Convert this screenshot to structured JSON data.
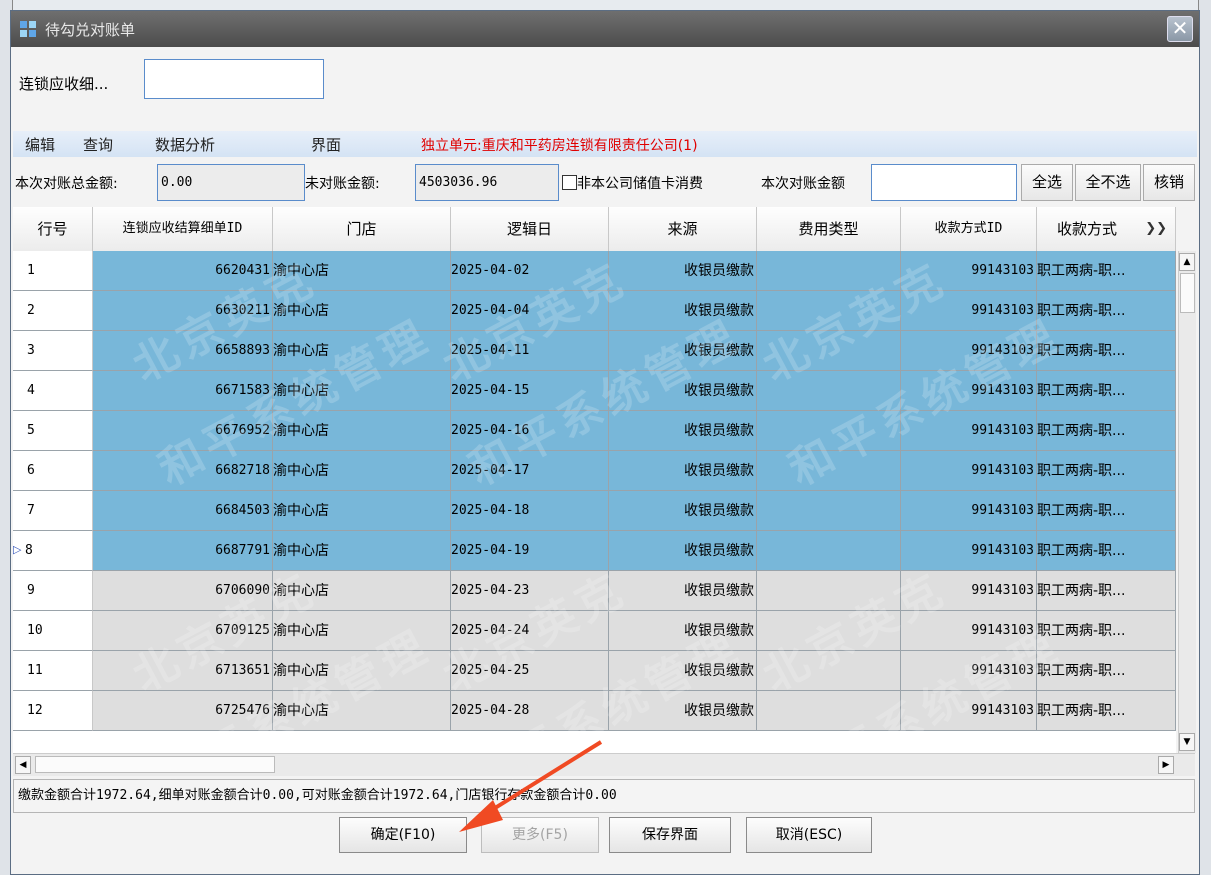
{
  "window": {
    "title": "待勾兑对账单",
    "close_symbol": "✕"
  },
  "filter": {
    "label": "连锁应收细...",
    "value": ""
  },
  "menu": {
    "items": [
      "编辑",
      "查询",
      "数据分析",
      "界面"
    ],
    "unit": "独立单元:重庆和平药房连锁有限责任公司(1)"
  },
  "toolbar": {
    "total_label": "本次对账总金额:",
    "total_value": "0.00",
    "unreconciled_label": "未对账金额:",
    "unreconciled_value": "4503036.96",
    "non_company_card_label": "非本公司储值卡消费",
    "current_amount_label": "本次对账金额",
    "current_amount_value": "",
    "select_all": "全选",
    "deselect_all": "全不选",
    "verify": "核销"
  },
  "grid": {
    "columns": [
      "行号",
      "连锁应收结算细单ID",
      "门店",
      "逻辑日",
      "来源",
      "费用类型",
      "收款方式ID",
      "收款方式"
    ],
    "rows": [
      {
        "no": "1",
        "id": "6620431",
        "store": "渝中心店",
        "date": "2025-04-02",
        "source": "收银员缴款",
        "fee": "",
        "pay_id": "99143103",
        "pay": "职工两病-职...",
        "selected": true
      },
      {
        "no": "2",
        "id": "6630211",
        "store": "渝中心店",
        "date": "2025-04-04",
        "source": "收银员缴款",
        "fee": "",
        "pay_id": "99143103",
        "pay": "职工两病-职...",
        "selected": true
      },
      {
        "no": "3",
        "id": "6658893",
        "store": "渝中心店",
        "date": "2025-04-11",
        "source": "收银员缴款",
        "fee": "",
        "pay_id": "99143103",
        "pay": "职工两病-职...",
        "selected": true
      },
      {
        "no": "4",
        "id": "6671583",
        "store": "渝中心店",
        "date": "2025-04-15",
        "source": "收银员缴款",
        "fee": "",
        "pay_id": "99143103",
        "pay": "职工两病-职...",
        "selected": true
      },
      {
        "no": "5",
        "id": "6676952",
        "store": "渝中心店",
        "date": "2025-04-16",
        "source": "收银员缴款",
        "fee": "",
        "pay_id": "99143103",
        "pay": "职工两病-职...",
        "selected": true
      },
      {
        "no": "6",
        "id": "6682718",
        "store": "渝中心店",
        "date": "2025-04-17",
        "source": "收银员缴款",
        "fee": "",
        "pay_id": "99143103",
        "pay": "职工两病-职...",
        "selected": true
      },
      {
        "no": "7",
        "id": "6684503",
        "store": "渝中心店",
        "date": "2025-04-18",
        "source": "收银员缴款",
        "fee": "",
        "pay_id": "99143103",
        "pay": "职工两病-职...",
        "selected": true
      },
      {
        "no": "8",
        "id": "6687791",
        "store": "渝中心店",
        "date": "2025-04-19",
        "source": "收银员缴款",
        "fee": "",
        "pay_id": "99143103",
        "pay": "职工两病-职...",
        "selected": true,
        "current": true
      },
      {
        "no": "9",
        "id": "6706090",
        "store": "渝中心店",
        "date": "2025-04-23",
        "source": "收银员缴款",
        "fee": "",
        "pay_id": "99143103",
        "pay": "职工两病-职...",
        "selected": false
      },
      {
        "no": "10",
        "id": "6709125",
        "store": "渝中心店",
        "date": "2025-04-24",
        "source": "收银员缴款",
        "fee": "",
        "pay_id": "99143103",
        "pay": "职工两病-职...",
        "selected": false
      },
      {
        "no": "11",
        "id": "6713651",
        "store": "渝中心店",
        "date": "2025-04-25",
        "source": "收银员缴款",
        "fee": "",
        "pay_id": "99143103",
        "pay": "职工两病-职...",
        "selected": false
      },
      {
        "no": "12",
        "id": "6725476",
        "store": "渝中心店",
        "date": "2025-04-28",
        "source": "收银员缴款",
        "fee": "",
        "pay_id": "99143103",
        "pay": "职工两病-职...",
        "selected": false
      }
    ],
    "watermark_lines": [
      "北京英克",
      "和平系统管理"
    ]
  },
  "status": "缴款金额合计1972.64,细单对账金额合计0.00,可对账金额合计1972.64,门店银行存款金额合计0.00",
  "buttons": {
    "ok": "确定(F10)",
    "more": "更多(F5)",
    "save_layout": "保存界面",
    "cancel": "取消(ESC)"
  },
  "colors": {
    "selected_row": "#78b7d9",
    "unselected_row": "#dedede",
    "unit_text": "#e00000",
    "annotation_arrow": "#f04a23"
  }
}
